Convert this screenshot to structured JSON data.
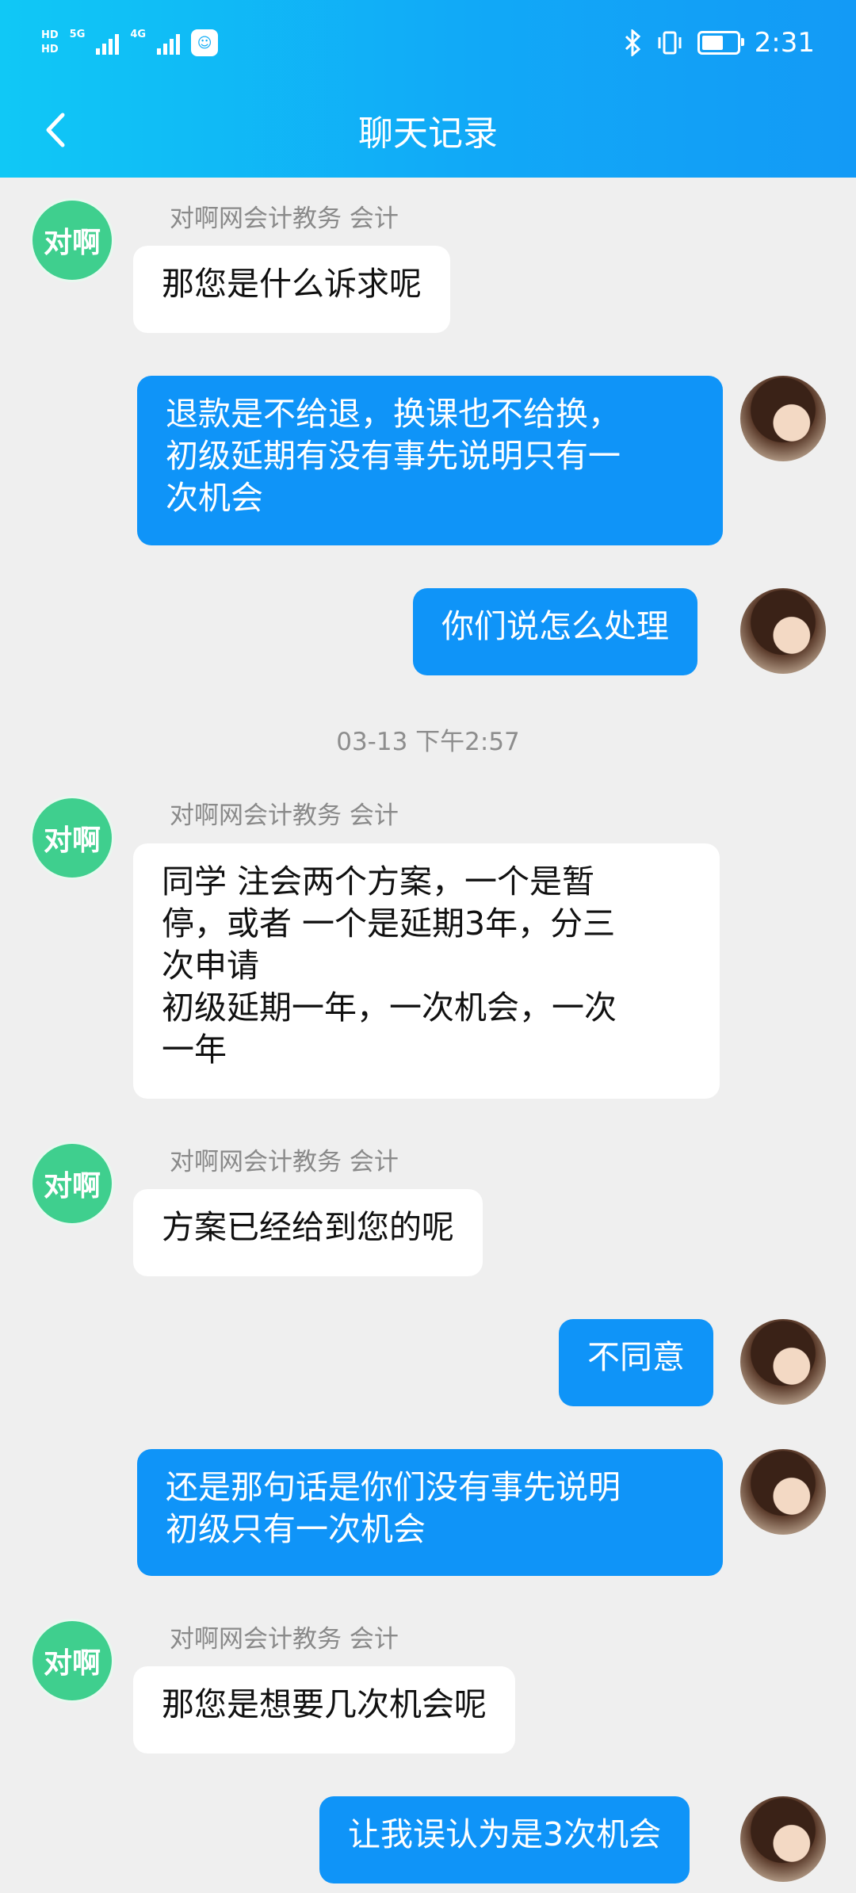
{
  "status_bar": {
    "left_hd1": "HD",
    "left_hd2": "HD",
    "net1": "5G",
    "net2": "4G",
    "time": "2:31"
  },
  "header": {
    "title": "聊天记录"
  },
  "messages": [
    {
      "sender": "对啊网会计教务   会计",
      "text": "那您是什么诉求呢"
    },
    {
      "text": "退款是不给退，换课也不给换，\n初级延期有没有事先说明只有一\n次机会"
    },
    {
      "text": "你们说怎么处理"
    },
    {
      "sender": "对啊网会计教务   会计",
      "text": "同学 注会两个方案，一个是暂\n停，或者 一个是延期3年，分三\n次申请\n初级延期一年，一次机会，一次\n一年"
    },
    {
      "sender": "对啊网会计教务   会计",
      "text": "方案已经给到您的呢"
    },
    {
      "text": "不同意"
    },
    {
      "text": "还是那句话是你们没有事先说明\n初级只有一次机会"
    },
    {
      "sender": "对啊网会计教务   会计",
      "text": "那您是想要几次机会呢"
    },
    {
      "text": "让我误认为是3次机会"
    }
  ],
  "timestamp": "03-13 下午2:57",
  "corp_avatar_text": "对啊"
}
